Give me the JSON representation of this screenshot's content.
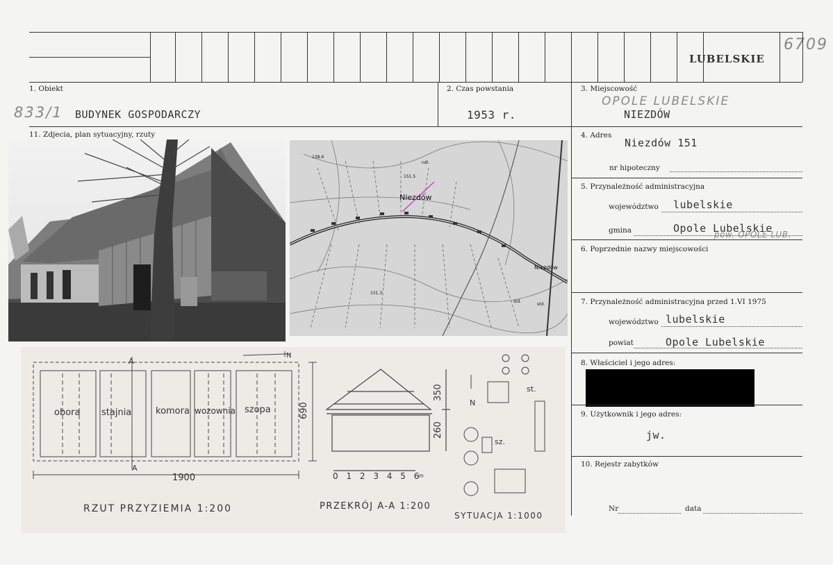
{
  "catalog_number": "6709",
  "region_stamp": "LUBELSKIE",
  "fields": {
    "obiekt": {
      "label": "1. Obiekt",
      "number": "833/1",
      "value": "BUDYNEK GOSPODARCZY"
    },
    "czas": {
      "label": "2. Czas powstania",
      "value": "1953 r."
    },
    "miejscowosc": {
      "label": "3. Miejscowość",
      "handwritten": "OPOLE LUBELSKIE",
      "value": "NIEZDÓW"
    },
    "zdjecia": {
      "label": "11. Zdjecia, plan sytuacyjny, rzuty"
    },
    "adres": {
      "label": "4. Adres",
      "value": "Niezdów 151",
      "hipoteczny_label": "nr hipoteczny"
    },
    "przynaleznosc": {
      "label": "5. Przynależność administracyjna",
      "woj_label": "województwo",
      "woj_value": "lubelskie",
      "gmina_label": "gmina",
      "gmina_value": "Opole Lubelskie",
      "gmina_note": "pow. OPOLE LUB."
    },
    "poprzednie": {
      "label": "6. Poprzednie nazwy miejscowości"
    },
    "przed1975": {
      "label": "7. Przynależność administracyjna przed 1.VI 1975",
      "woj_label": "województwo",
      "woj_value": "lubelskie",
      "powiat_label": "powiat",
      "powiat_value": "Opole Lubelskie"
    },
    "wlasciciel": {
      "label": "8. Właściciel i jego adres:"
    },
    "uzytkownik": {
      "label": "9. Użytkownik i jego adres:",
      "value": "jw."
    },
    "rejestr": {
      "label": "10. Rejestr zabytków",
      "nr_label": "Nr",
      "data_label": "data"
    }
  },
  "map": {
    "place": "Niezdów",
    "place2": "Niezdów",
    "heights": [
      "138.6",
      "151.5",
      "151.3"
    ],
    "abbr": [
      "ndl.",
      "std.",
      "std."
    ]
  },
  "plan": {
    "rooms": [
      "obora",
      "stajnia",
      "komora",
      "wozownia",
      "szopa"
    ],
    "length": "1900",
    "width": "690",
    "marker_a": "A",
    "north": "N",
    "title": "RZUT PRZYZIEMIA 1:200"
  },
  "section": {
    "dim_top": "350",
    "dim_bottom": "260",
    "scale": "0 1 2 3 4 5 6",
    "unit": "m",
    "title": "PRZEKRÓJ A-A 1:200"
  },
  "situation": {
    "north": "N",
    "st": "st.",
    "sz": "sz.",
    "title": "SYTUACJA 1:1000"
  }
}
